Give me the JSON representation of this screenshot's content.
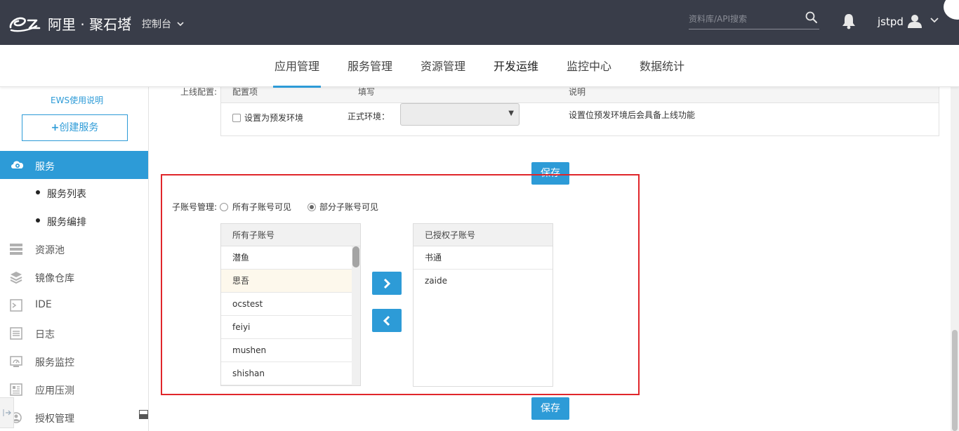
{
  "header": {
    "brand": "阿里 · 聚石塔",
    "separator": "/",
    "console_label": "控制台",
    "search_placeholder": "资料库/API搜索",
    "username": "jstpd"
  },
  "nav": {
    "items": [
      "应用管理",
      "服务管理",
      "资源管理",
      "开发运维",
      "监控中心",
      "数据统计"
    ],
    "active": "应用管理"
  },
  "sidebar": {
    "ews_link": "EWS使用说明",
    "create_button": "创建服务",
    "active_item": "服务",
    "submenu": [
      "服务列表",
      "服务编排"
    ],
    "items": [
      {
        "label": "资源池",
        "icon": "storage-icon"
      },
      {
        "label": "镜像仓库",
        "icon": "layers-icon"
      },
      {
        "label": "IDE",
        "icon": "terminal-icon"
      },
      {
        "label": "日志",
        "icon": "log-icon"
      },
      {
        "label": "服务监控",
        "icon": "monitor-icon"
      },
      {
        "label": "应用压测",
        "icon": "pressure-test-icon"
      },
      {
        "label": "授权管理",
        "icon": "auth-icon"
      }
    ]
  },
  "config": {
    "online_label": "上线配置:",
    "columns": [
      "配置项",
      "填写",
      "说明"
    ],
    "checkbox_label": "设置为预发环境",
    "env_label": "正式环境：",
    "env_select_value": "",
    "description": "设置位预发环境后会具备上线功能"
  },
  "save_label": "保存",
  "subaccount": {
    "label": "子账号管理:",
    "option_all": "所有子账号可见",
    "option_partial": "部分子账号可见",
    "selected_option": "部分子账号可见",
    "all_list_title": "所有子账号",
    "all_list": [
      "潜鱼",
      "思吾",
      "ocstest",
      "feiyi",
      "mushen",
      "shishan"
    ],
    "authorized_list_title": "已授权子账号",
    "authorized_list": [
      "书通",
      "zaide"
    ]
  },
  "colors": {
    "topbar": "#393d49",
    "accent": "#2d9bd7",
    "highlight_box": "#e0262b"
  }
}
